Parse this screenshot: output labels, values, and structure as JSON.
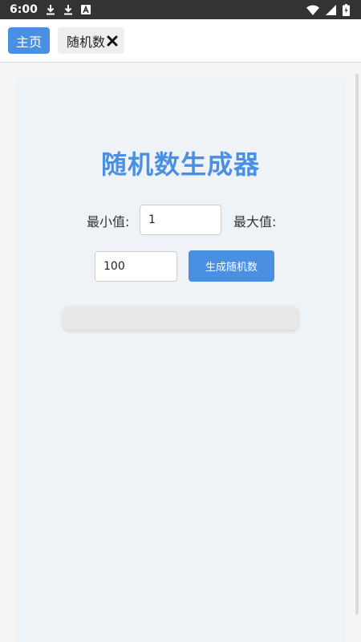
{
  "status_bar": {
    "time": "6:00",
    "icons": [
      "download-icon",
      "download-icon",
      "a-box-icon",
      "wifi-icon",
      "signal-icon",
      "battery-charging-icon"
    ]
  },
  "tabs": {
    "home_label": "主页",
    "random_label": "随机数",
    "active_color": "#4a90e2"
  },
  "main": {
    "title": "随机数生成器",
    "min_label": "最小值:",
    "max_label": "最大值:",
    "min_value": "1",
    "max_value": "100",
    "generate_label": "生成随机数",
    "result": ""
  },
  "colors": {
    "accent": "#4a90e2",
    "card_bg": "#eff3f8"
  }
}
